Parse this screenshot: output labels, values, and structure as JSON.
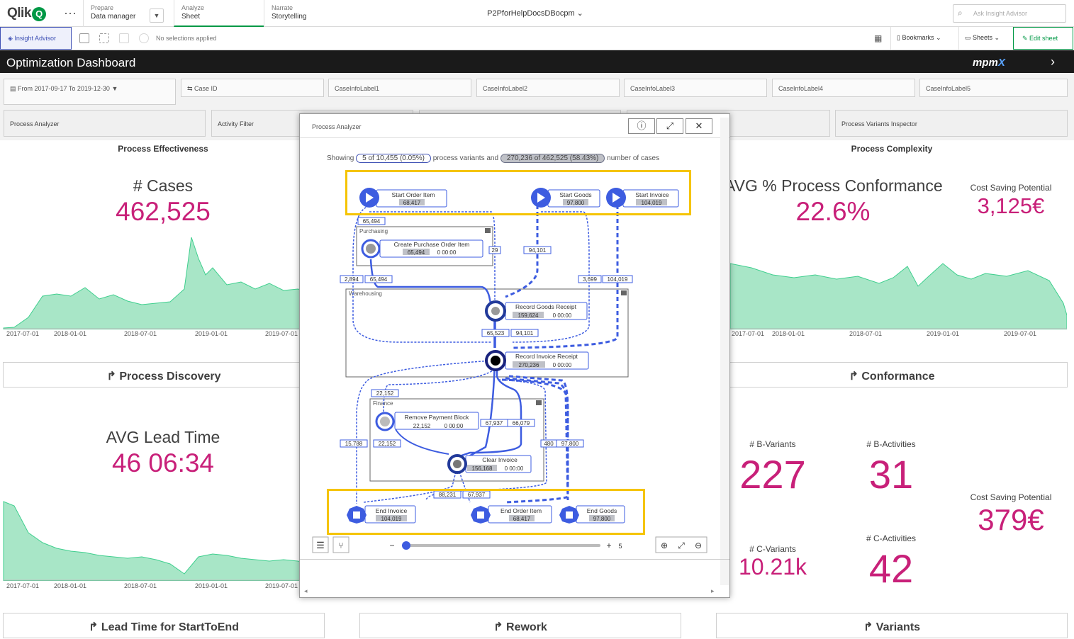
{
  "topbar": {
    "logo": "Qlik",
    "logo_q": "Q",
    "prepare_small": "Prepare",
    "prepare_big": "Data manager",
    "analyze_small": "Analyze",
    "analyze_big": "Sheet",
    "narrate_small": "Narrate",
    "narrate_big": "Storytelling",
    "app_title": "P2PforHelpDocsDBocpm",
    "ask_placeholder": "Ask Insight Advisor"
  },
  "toolbar": {
    "insight": "Insight Advisor",
    "no_selections": "No selections applied",
    "bookmarks": "Bookmarks",
    "sheets": "Sheets",
    "edit_sheet": "Edit sheet"
  },
  "titlebar": {
    "title": "Optimization Dashboard",
    "brand": "mpm",
    "brand_x": "X"
  },
  "filters": {
    "date": "From 2017-09-17 To 2019-12-30",
    "case_id": "Case ID",
    "l1": "CaseInfoLabel1",
    "l2": "CaseInfoLabel2",
    "l3": "CaseInfoLabel3",
    "l4": "CaseInfoLabel4",
    "l5": "CaseInfoLabel5"
  },
  "nav": {
    "process_analyzer": "Process Analyzer",
    "activity_filter": "Activity Filter",
    "variants_inspector": "Process Variants Inspector"
  },
  "left": {
    "section": "Process Effectiveness",
    "cases_label": "# Cases",
    "cases_value": "462,525",
    "lead_label": "AVG Lead Time",
    "lead_value": "46 06:34",
    "ticks": [
      "2017-07-01",
      "2018-01-01",
      "2018-07-01",
      "2019-01-01",
      "2019-07-01"
    ],
    "btn_discovery": "Process Discovery",
    "btn_lead": "Lead Time for StartToEnd"
  },
  "right": {
    "section": "Process Complexity",
    "conf_label": "AVG % Process Conformance",
    "conf_value": "22.6%",
    "csp_label": "Cost Saving Potential",
    "csp_value": "3,125€",
    "ticks": [
      "2017-07-01",
      "2018-01-01",
      "2018-07-01",
      "2019-01-01",
      "2019-07-01"
    ],
    "btn_conformance": "Conformance",
    "bvar_label": "# B-Variants",
    "bvar_value": "227",
    "bact_label": "# B-Activities",
    "bact_value": "31",
    "csp2_label": "Cost Saving Potential",
    "csp2_value": "379€",
    "cvar_label": "# C-Variants",
    "cvar_value": "10.21k",
    "cact_label": "# C-Activities",
    "cact_value": "42",
    "btn_variants": "Variants"
  },
  "mid": {
    "btn_rework": "Rework"
  },
  "modal": {
    "title": "Process Analyzer",
    "showing": "Showing",
    "variants_pill": "5 of 10,455 (0.05%)",
    "variants_text": "process variants and",
    "cases_pill": "270,236 of 462,525 (58.43%)",
    "cases_text": "number of cases",
    "slider_value": "5",
    "slider_min": "−",
    "slider_plus": "+",
    "groups": {
      "purchasing": "Purchasing",
      "warehousing": "Warehousing",
      "finance": "Finance"
    },
    "nodes": {
      "start_order": {
        "name": "Start Order Item",
        "count": "68,417"
      },
      "start_goods": {
        "name": "Start Goods",
        "count": "97,800"
      },
      "start_invoice": {
        "name": "Start Invoice",
        "count": "104,019"
      },
      "create_po": {
        "name": "Create Purchase Order Item",
        "count": "65,494",
        "time": "0 00:00"
      },
      "record_gr": {
        "name": "Record Goods Receipt",
        "count": "159,624",
        "time": "0 00:00"
      },
      "record_ir": {
        "name": "Record Invoice Receipt",
        "count": "270,236",
        "time": "0 00:00"
      },
      "remove_pb": {
        "name": "Remove Payment Block",
        "count": "22,152",
        "time": "0 00:00"
      },
      "clear_inv": {
        "name": "Clear Invoice",
        "count": "156,168",
        "time": "0 00:00"
      },
      "end_invoice": {
        "name": "End Invoice",
        "count": "104,019"
      },
      "end_order": {
        "name": "End Order Item",
        "count": "68,417"
      },
      "end_goods": {
        "name": "End Goods",
        "count": "97,800"
      }
    },
    "edges": {
      "e1": "65,494",
      "e2": "29",
      "e3": "94,101",
      "e4": "2,894",
      "e5": "65,494",
      "e6": "3,699",
      "e7": "104,019",
      "e8": "65,523",
      "e9": "94,101",
      "e10": "22,152",
      "e11": "67,937",
      "e12": "66,079",
      "e13": "15,788",
      "e14": "22,152",
      "e15": "480",
      "e16": "97,800",
      "e17": "88,231",
      "e18": "67,937"
    }
  },
  "colors": {
    "kpi": "#c82079",
    "accent": "#009845",
    "flow": "#3d5ce0",
    "highlight": "#f5c400",
    "area": "#a8e6c7"
  }
}
